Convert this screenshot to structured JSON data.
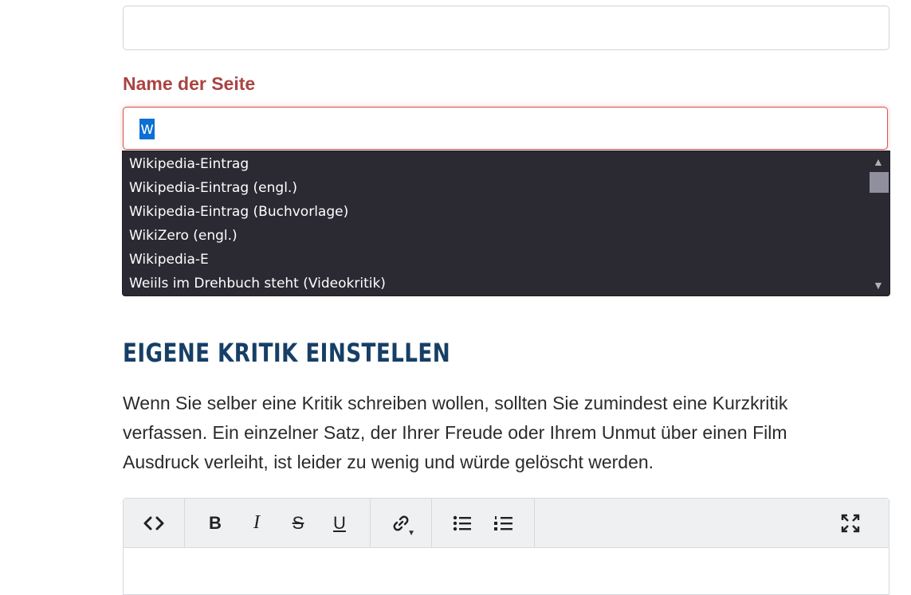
{
  "form": {
    "top_input_value": "",
    "name_label": "Name der Seite",
    "name_value": "w",
    "suggestions": [
      "Wikipedia-Eintrag",
      "Wikipedia-Eintrag (engl.)",
      "Wikipedia-Eintrag (Buchvorlage)",
      "WikiZero (engl.)",
      "Wikipedia-E",
      "Weiils im Drehbuch steht (Videokritik)"
    ]
  },
  "section": {
    "heading": "EIGENE KRITIK EINSTELLEN",
    "paragraph": "Wenn Sie selber eine Kritik schreiben wollen, sollten Sie zumindest eine Kurzkritik verfassen. Ein einzelner Satz, der Ihrer Freude oder Ihrem Unmut über einen Film Ausdruck verleiht, ist leider zu wenig und würde gelöscht werden."
  },
  "toolbar": {
    "code": "<>",
    "bold": "B",
    "italic": "I",
    "strike": "S",
    "underline": "U"
  },
  "colors": {
    "label_error": "#a94442",
    "heading": "#173f66",
    "dropdown_bg": "#2b2a33",
    "selection": "#0b6fd4"
  }
}
